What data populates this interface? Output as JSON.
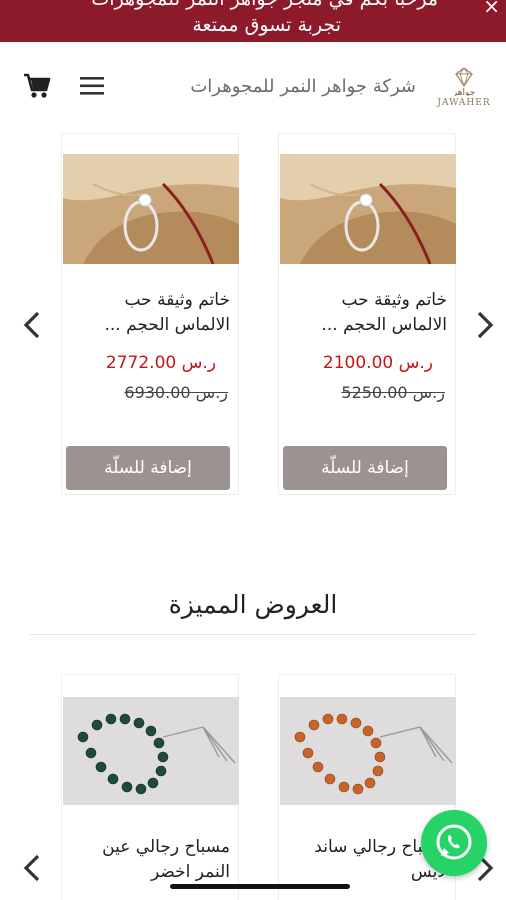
{
  "banner": {
    "line1": "مرحبا بكم في متجر جواهر النمر للمجوهرات",
    "line2": "تجربة تسوق ممتعة",
    "close_label": "×"
  },
  "header": {
    "brand_name": "شركة جواهر النمر للمجوهرات",
    "logo_text_ar": "جواهر",
    "logo_text_en": "JAWAHER"
  },
  "product_carousel": {
    "products": [
      {
        "title": "خاتم وثيقة حب الالماس الحجم ...",
        "price": "ر.س 2100.00",
        "old_price": "ر.س 5250.00",
        "button": "إضافة للسلّة"
      },
      {
        "title": "خاتم وثيقة حب الالماس الحجم ...",
        "price": "ر.س 2772.00",
        "old_price": "ر.س 6930.00",
        "button": "إضافة للسلّة"
      }
    ]
  },
  "featured": {
    "title": "العروض المميزة",
    "products": [
      {
        "title": "مسباح رجالي ساند لايس"
      },
      {
        "title": "مسباح رجالي عين النمر اخضر"
      }
    ]
  },
  "colors": {
    "banner_bg": "#8c1a2b",
    "price_red": "#c4161c",
    "button_gray": "#9c9391",
    "whatsapp_green": "#25d366"
  },
  "icons": {
    "cart": "cart-icon",
    "menu": "hamburger-menu-icon",
    "prev": "chevron-left-icon",
    "next": "chevron-right-icon",
    "close": "close-icon",
    "whatsapp": "whatsapp-icon"
  }
}
